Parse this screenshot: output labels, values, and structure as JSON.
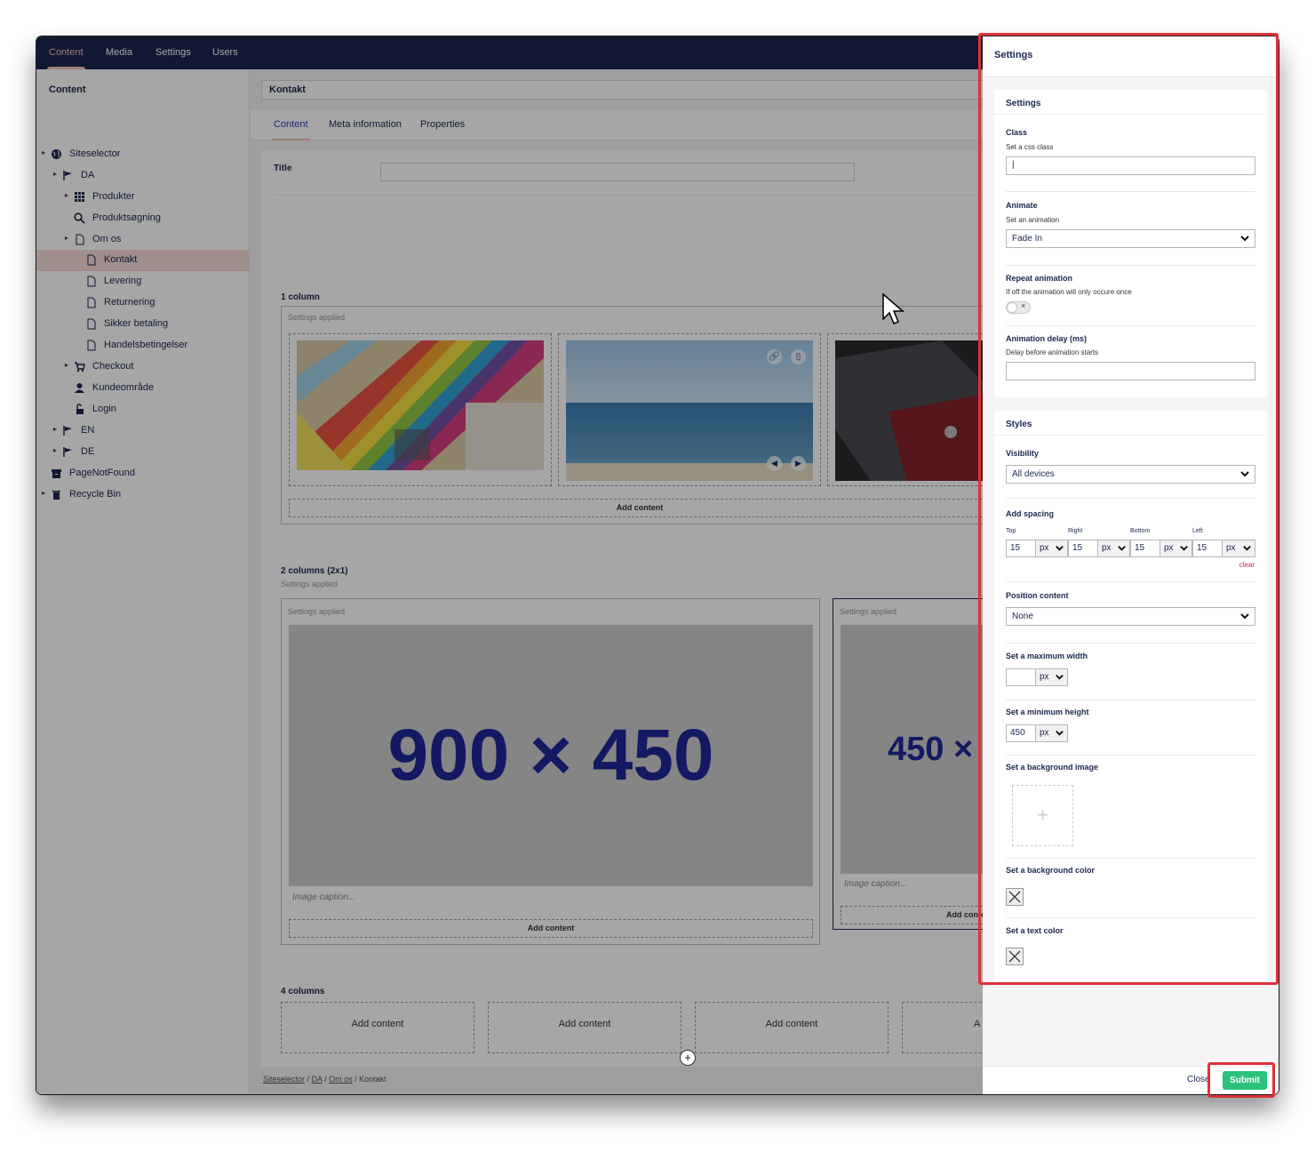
{
  "topnav": {
    "tabs": [
      "Content",
      "Media",
      "Settings",
      "Users"
    ]
  },
  "tree": {
    "heading": "Content",
    "items": [
      {
        "label": "Siteselector",
        "icon": "globe-icon"
      },
      {
        "label": "DA",
        "icon": "flag-icon"
      },
      {
        "label": "Produkter",
        "icon": "grid-icon"
      },
      {
        "label": "Produktsøgning",
        "icon": "search-icon"
      },
      {
        "label": "Om os",
        "icon": "document-icon"
      },
      {
        "label": "Kontakt",
        "icon": "document-icon"
      },
      {
        "label": "Levering",
        "icon": "document-icon"
      },
      {
        "label": "Returnering",
        "icon": "document-icon"
      },
      {
        "label": "Sikker betaling",
        "icon": "document-icon"
      },
      {
        "label": "Handelsbetingelser",
        "icon": "document-icon"
      },
      {
        "label": "Checkout",
        "icon": "cart-icon"
      },
      {
        "label": "Kundeområde",
        "icon": "user-icon"
      },
      {
        "label": "Login",
        "icon": "unlock-icon"
      },
      {
        "label": "EN",
        "icon": "flag-icon"
      },
      {
        "label": "DE",
        "icon": "flag-icon"
      },
      {
        "label": "PageNotFound",
        "icon": "archive-icon"
      },
      {
        "label": "Recycle Bin",
        "icon": "trash-icon"
      }
    ]
  },
  "main": {
    "node_name": "Kontakt",
    "tabs": [
      "Content",
      "Meta information",
      "Properties"
    ],
    "title_label": "Title",
    "grid": {
      "one_column": {
        "label": "1 column",
        "settings_applied": "Settings applied",
        "add_content": "Add content"
      },
      "two_columns": {
        "label": "2 columns (2x1)",
        "settings_applied": "Settings applied",
        "left": {
          "settings_applied": "Settings applied",
          "placeholder": "900 × 450",
          "caption": "Image caption...",
          "add_content": "Add content"
        },
        "right": {
          "settings_applied": "Settings applied",
          "placeholder": "450 ×",
          "caption": "Image caption...",
          "add_content": "Add conte"
        }
      },
      "four_columns": {
        "label": "4 columns",
        "cells": [
          "Add content",
          "Add content",
          "Add content",
          "A"
        ]
      }
    },
    "breadcrumb": [
      "Siteselector",
      "DA",
      "Om os",
      "Kontakt"
    ]
  },
  "dialog": {
    "title": "Settings",
    "settings_card": {
      "title": "Settings",
      "class_label": "Class",
      "class_desc": "Set a css class",
      "class_value": "|",
      "animate_label": "Animate",
      "animate_desc": "Set an animation",
      "animate_value": "Fade In",
      "repeat_label": "Repeat animation",
      "repeat_desc": "If off the animation will only occure once",
      "repeat_on": false,
      "delay_label": "Animation delay (ms)",
      "delay_desc": "Delay before animation starts",
      "delay_value": ""
    },
    "styles_card": {
      "title": "Styles",
      "visibility_label": "Visibility",
      "visibility_value": "All devices",
      "spacing_label": "Add spacing",
      "spacing": [
        {
          "side": "Top",
          "value": "15",
          "unit": "px"
        },
        {
          "side": "Right",
          "value": "15",
          "unit": "px"
        },
        {
          "side": "Bottom",
          "value": "15",
          "unit": "px"
        },
        {
          "side": "Left",
          "value": "15",
          "unit": "px"
        }
      ],
      "clear_label": "clear",
      "position_label": "Position content",
      "position_value": "None",
      "max_width_label": "Set a maximum width",
      "max_width_value": "",
      "max_width_unit": "px",
      "min_height_label": "Set a minimum height",
      "min_height_value": "450",
      "min_height_unit": "px",
      "bg_image_label": "Set a background image",
      "bg_color_label": "Set a background color",
      "text_color_label": "Set a text color"
    },
    "close_label": "Close",
    "submit_label": "Submit"
  },
  "colors": {
    "nav_bg": "#1b264f",
    "accent": "#f5c1bc",
    "submit": "#2bc37c",
    "highlight": "#e03039"
  }
}
